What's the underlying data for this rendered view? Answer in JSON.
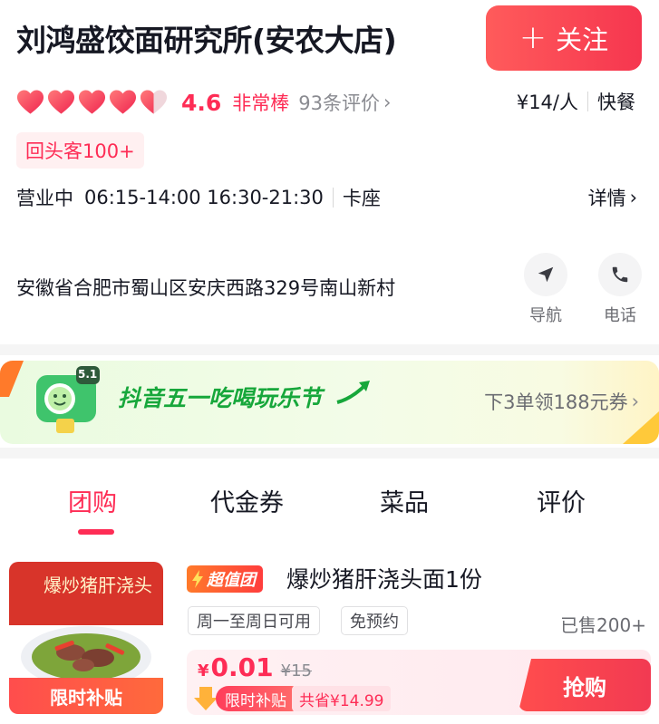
{
  "store": {
    "name": "刘鸿盛饺面研究所(安农大店)",
    "follow_label": "关注",
    "rating_hearts": 4.5,
    "score": "4.6",
    "level": "非常棒",
    "reviews": "93条评价",
    "price_per_person": "¥14/人",
    "category": "快餐",
    "repeat_tag": "回头客100+",
    "status": "营业中",
    "hours": "06:15-14:00 16:30-21:30",
    "seating": "卡座",
    "detail_label": "详情",
    "address": "安徽省合肥市蜀山区安庆西路329号南山新村",
    "nav_label": "导航",
    "phone_label": "电话"
  },
  "banner": {
    "badge": "5.1",
    "title": "抖音五一吃喝玩乐节",
    "right_text": "下3单领188元券"
  },
  "tabs": [
    {
      "label": "团购"
    },
    {
      "label": "代金券"
    },
    {
      "label": "菜品"
    },
    {
      "label": "评价"
    }
  ],
  "deal": {
    "image_caption": "爆炒猪肝浇头",
    "image_badge": "限时补贴",
    "super_badge": "超值团",
    "title": "爆炒猪肝浇头面1份",
    "chips": [
      "周一至周日可用",
      "免预约"
    ],
    "sold": "已售200+",
    "currency": "¥",
    "price": "0.01",
    "original_price": "¥15",
    "subsidy": "限时补贴",
    "saving": "共省¥14.99",
    "buy_label": "抢购"
  },
  "colors": {
    "accent": "#fe2c55",
    "banner_green": "#17a73b"
  }
}
